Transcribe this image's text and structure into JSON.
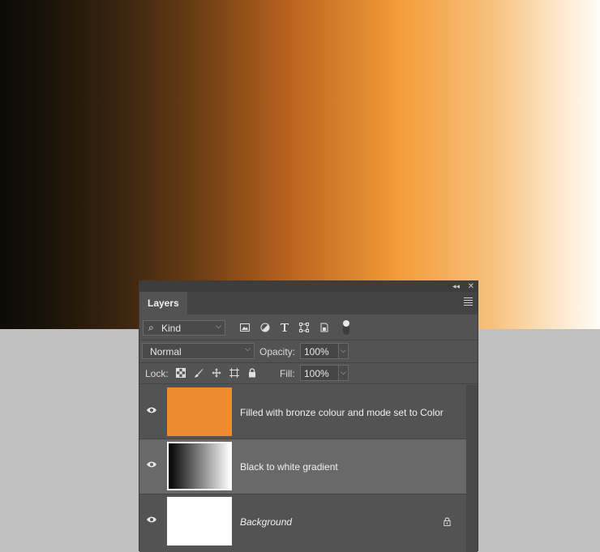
{
  "canvas": {
    "gradient_start": "#0d0b07",
    "gradient_mid": "#f39b38",
    "gradient_end": "#fffdf8",
    "pasteboard": "#c0c0c0"
  },
  "panel": {
    "tab_label": "Layers",
    "filter": {
      "kind_label": "Kind",
      "icons": [
        "image-filter-icon",
        "adjustment-filter-icon",
        "type-filter-icon",
        "shape-filter-icon",
        "smart-object-filter-icon",
        "filter-toggle-icon"
      ]
    },
    "blend_mode": "Normal",
    "opacity_label": "Opacity:",
    "opacity_value": "100%",
    "lock_label": "Lock:",
    "fill_label": "Fill:",
    "fill_value": "100%",
    "layers": [
      {
        "name": "Filled with bronze colour and mode set to Color",
        "thumb_color": "#ee8a2f",
        "visible": true,
        "selected": false
      },
      {
        "name": "Black to white gradient",
        "thumb_type": "gradient",
        "visible": true,
        "selected": true
      },
      {
        "name": "Background",
        "thumb_color": "#ffffff",
        "visible": true,
        "selected": false,
        "locked": true
      }
    ]
  }
}
